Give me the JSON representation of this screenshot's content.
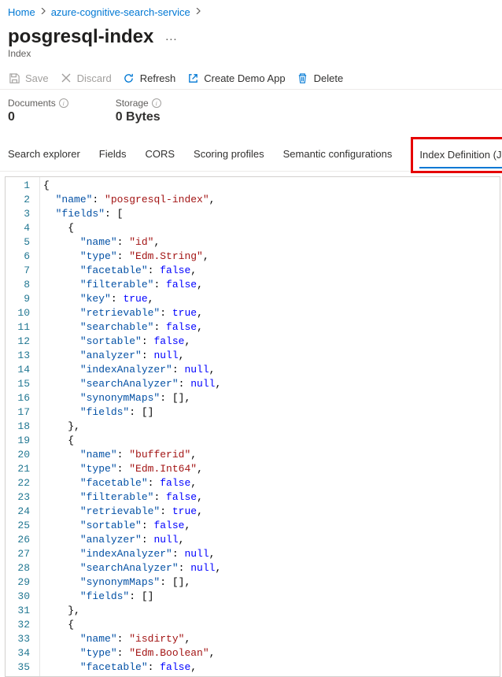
{
  "breadcrumb": {
    "home": "Home",
    "service": "azure-cognitive-search-service"
  },
  "title": "posgresql-index",
  "subtitle": "Index",
  "more": "…",
  "toolbar": {
    "save": "Save",
    "discard": "Discard",
    "refresh": "Refresh",
    "create_demo": "Create Demo App",
    "delete": "Delete"
  },
  "stats": {
    "documents_label": "Documents",
    "documents_value": "0",
    "storage_label": "Storage",
    "storage_value": "0 Bytes"
  },
  "tabs": {
    "search_explorer": "Search explorer",
    "fields": "Fields",
    "cors": "CORS",
    "scoring": "Scoring profiles",
    "semantic": "Semantic configurations",
    "index_def": "Index Definition (JSON)"
  },
  "code_lines": [
    [
      [
        "punc",
        "{"
      ]
    ],
    [
      [
        "indent",
        1
      ],
      [
        "key",
        "\"name\""
      ],
      [
        "punc",
        ": "
      ],
      [
        "str",
        "\"posgresql-index\""
      ],
      [
        "punc",
        ","
      ]
    ],
    [
      [
        "indent",
        1
      ],
      [
        "key",
        "\"fields\""
      ],
      [
        "punc",
        ": ["
      ]
    ],
    [
      [
        "indent",
        2
      ],
      [
        "punc",
        "{"
      ]
    ],
    [
      [
        "indent",
        3
      ],
      [
        "key",
        "\"name\""
      ],
      [
        "punc",
        ": "
      ],
      [
        "str",
        "\"id\""
      ],
      [
        "punc",
        ","
      ]
    ],
    [
      [
        "indent",
        3
      ],
      [
        "key",
        "\"type\""
      ],
      [
        "punc",
        ": "
      ],
      [
        "str",
        "\"Edm.String\""
      ],
      [
        "punc",
        ","
      ]
    ],
    [
      [
        "indent",
        3
      ],
      [
        "key",
        "\"facetable\""
      ],
      [
        "punc",
        ": "
      ],
      [
        "bool",
        "false"
      ],
      [
        "punc",
        ","
      ]
    ],
    [
      [
        "indent",
        3
      ],
      [
        "key",
        "\"filterable\""
      ],
      [
        "punc",
        ": "
      ],
      [
        "bool",
        "false"
      ],
      [
        "punc",
        ","
      ]
    ],
    [
      [
        "indent",
        3
      ],
      [
        "key",
        "\"key\""
      ],
      [
        "punc",
        ": "
      ],
      [
        "bool",
        "true"
      ],
      [
        "punc",
        ","
      ]
    ],
    [
      [
        "indent",
        3
      ],
      [
        "key",
        "\"retrievable\""
      ],
      [
        "punc",
        ": "
      ],
      [
        "bool",
        "true"
      ],
      [
        "punc",
        ","
      ]
    ],
    [
      [
        "indent",
        3
      ],
      [
        "key",
        "\"searchable\""
      ],
      [
        "punc",
        ": "
      ],
      [
        "bool",
        "false"
      ],
      [
        "punc",
        ","
      ]
    ],
    [
      [
        "indent",
        3
      ],
      [
        "key",
        "\"sortable\""
      ],
      [
        "punc",
        ": "
      ],
      [
        "bool",
        "false"
      ],
      [
        "punc",
        ","
      ]
    ],
    [
      [
        "indent",
        3
      ],
      [
        "key",
        "\"analyzer\""
      ],
      [
        "punc",
        ": "
      ],
      [
        "null",
        "null"
      ],
      [
        "punc",
        ","
      ]
    ],
    [
      [
        "indent",
        3
      ],
      [
        "key",
        "\"indexAnalyzer\""
      ],
      [
        "punc",
        ": "
      ],
      [
        "null",
        "null"
      ],
      [
        "punc",
        ","
      ]
    ],
    [
      [
        "indent",
        3
      ],
      [
        "key",
        "\"searchAnalyzer\""
      ],
      [
        "punc",
        ": "
      ],
      [
        "null",
        "null"
      ],
      [
        "punc",
        ","
      ]
    ],
    [
      [
        "indent",
        3
      ],
      [
        "key",
        "\"synonymMaps\""
      ],
      [
        "punc",
        ": []"
      ],
      [
        "punc",
        ","
      ]
    ],
    [
      [
        "indent",
        3
      ],
      [
        "key",
        "\"fields\""
      ],
      [
        "punc",
        ": []"
      ]
    ],
    [
      [
        "indent",
        2
      ],
      [
        "punc",
        "},"
      ]
    ],
    [
      [
        "indent",
        2
      ],
      [
        "punc",
        "{"
      ]
    ],
    [
      [
        "indent",
        3
      ],
      [
        "key",
        "\"name\""
      ],
      [
        "punc",
        ": "
      ],
      [
        "str",
        "\"bufferid\""
      ],
      [
        "punc",
        ","
      ]
    ],
    [
      [
        "indent",
        3
      ],
      [
        "key",
        "\"type\""
      ],
      [
        "punc",
        ": "
      ],
      [
        "str",
        "\"Edm.Int64\""
      ],
      [
        "punc",
        ","
      ]
    ],
    [
      [
        "indent",
        3
      ],
      [
        "key",
        "\"facetable\""
      ],
      [
        "punc",
        ": "
      ],
      [
        "bool",
        "false"
      ],
      [
        "punc",
        ","
      ]
    ],
    [
      [
        "indent",
        3
      ],
      [
        "key",
        "\"filterable\""
      ],
      [
        "punc",
        ": "
      ],
      [
        "bool",
        "false"
      ],
      [
        "punc",
        ","
      ]
    ],
    [
      [
        "indent",
        3
      ],
      [
        "key",
        "\"retrievable\""
      ],
      [
        "punc",
        ": "
      ],
      [
        "bool",
        "true"
      ],
      [
        "punc",
        ","
      ]
    ],
    [
      [
        "indent",
        3
      ],
      [
        "key",
        "\"sortable\""
      ],
      [
        "punc",
        ": "
      ],
      [
        "bool",
        "false"
      ],
      [
        "punc",
        ","
      ]
    ],
    [
      [
        "indent",
        3
      ],
      [
        "key",
        "\"analyzer\""
      ],
      [
        "punc",
        ": "
      ],
      [
        "null",
        "null"
      ],
      [
        "punc",
        ","
      ]
    ],
    [
      [
        "indent",
        3
      ],
      [
        "key",
        "\"indexAnalyzer\""
      ],
      [
        "punc",
        ": "
      ],
      [
        "null",
        "null"
      ],
      [
        "punc",
        ","
      ]
    ],
    [
      [
        "indent",
        3
      ],
      [
        "key",
        "\"searchAnalyzer\""
      ],
      [
        "punc",
        ": "
      ],
      [
        "null",
        "null"
      ],
      [
        "punc",
        ","
      ]
    ],
    [
      [
        "indent",
        3
      ],
      [
        "key",
        "\"synonymMaps\""
      ],
      [
        "punc",
        ": []"
      ],
      [
        "punc",
        ","
      ]
    ],
    [
      [
        "indent",
        3
      ],
      [
        "key",
        "\"fields\""
      ],
      [
        "punc",
        ": []"
      ]
    ],
    [
      [
        "indent",
        2
      ],
      [
        "punc",
        "},"
      ]
    ],
    [
      [
        "indent",
        2
      ],
      [
        "punc",
        "{"
      ]
    ],
    [
      [
        "indent",
        3
      ],
      [
        "key",
        "\"name\""
      ],
      [
        "punc",
        ": "
      ],
      [
        "str",
        "\"isdirty\""
      ],
      [
        "punc",
        ","
      ]
    ],
    [
      [
        "indent",
        3
      ],
      [
        "key",
        "\"type\""
      ],
      [
        "punc",
        ": "
      ],
      [
        "str",
        "\"Edm.Boolean\""
      ],
      [
        "punc",
        ","
      ]
    ],
    [
      [
        "indent",
        3
      ],
      [
        "key",
        "\"facetable\""
      ],
      [
        "punc",
        ": "
      ],
      [
        "bool",
        "false"
      ],
      [
        "punc",
        ","
      ]
    ]
  ]
}
